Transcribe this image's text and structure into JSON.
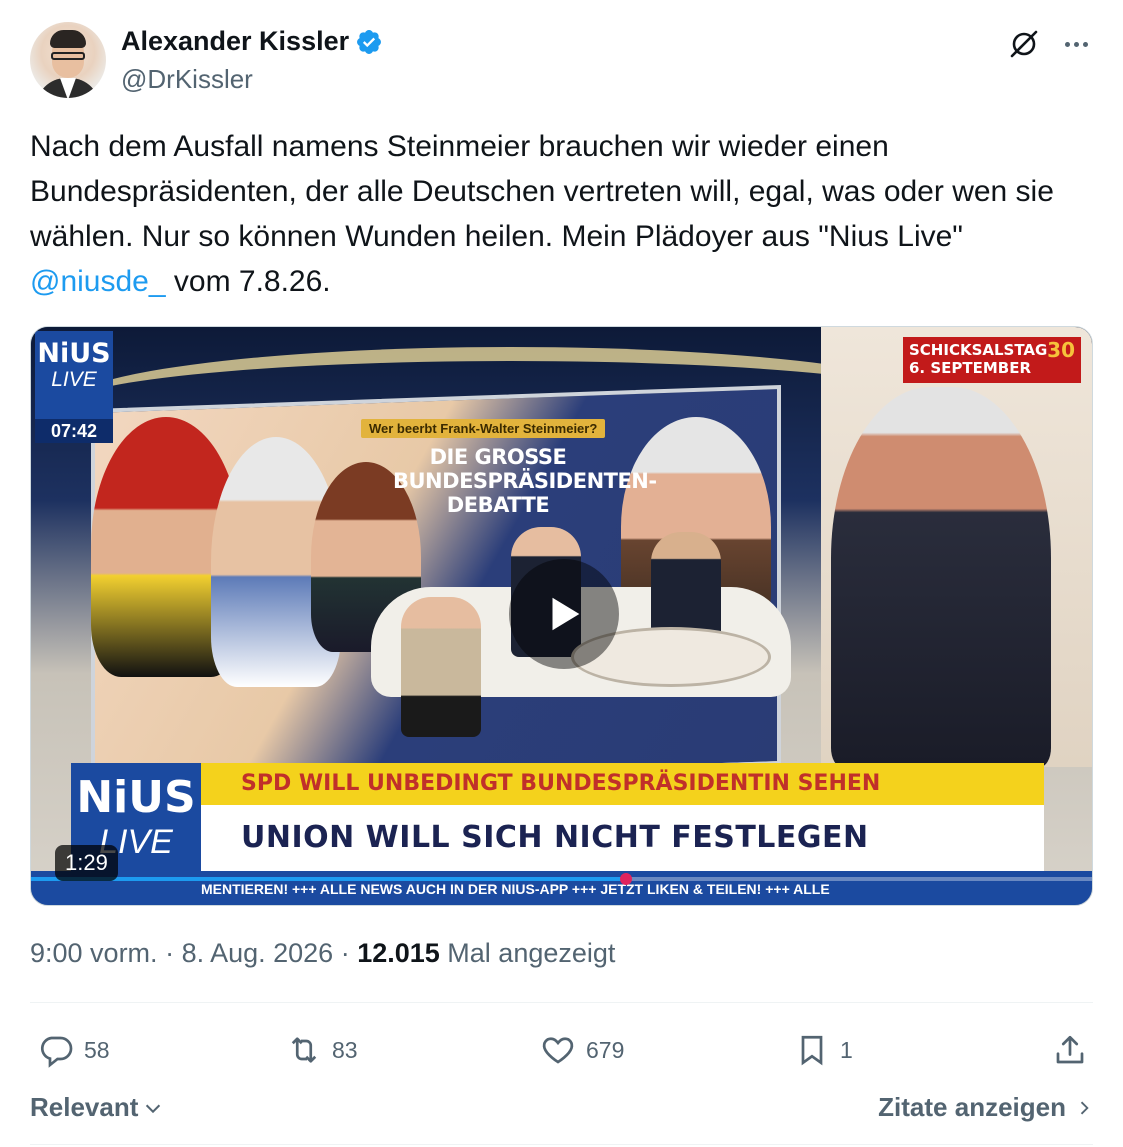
{
  "author": {
    "name": "Alexander Kissler",
    "handle": "@DrKissler",
    "verified": true
  },
  "tweet": {
    "text_before": "Nach dem Ausfall namens Steinmeier brauchen wir wieder einen Bundespräsidenten, der alle Deutschen vertreten will, egal, was oder wen sie wählen. Nur so können Wunden heilen. Mein Plädoyer aus \"Nius Live\" ",
    "mention": "@niusde_",
    "text_after": " vom 7.8.26."
  },
  "video": {
    "duration": "1:29",
    "progress_fraction": 0.56,
    "overlay": {
      "logo_top_line1": "NiUS",
      "logo_top_line2": "LIVE",
      "clock": "07:42",
      "kicker": "Wer beerbt Frank-Walter Steinmeier?",
      "debate_title": "DIE GROSSE BUNDESPRÄSIDENTEN-DEBATTE",
      "countdown_line1": "SCHICKSALSTAG",
      "countdown_line2": "6. SEPTEMBER",
      "countdown_days": "30",
      "banner_top": "SPD WILL UNBEDINGT BUNDESPRÄSIDENTIN SEHEN",
      "banner_main": "UNION WILL SICH NICHT FESTLEGEN",
      "logo_bottom_line1": "NiUS",
      "logo_bottom_line2": "LIVE",
      "ticker": "MENTIEREN!   +++   ALLE NEWS AUCH IN DER NIUS-APP   +++   JETZT LIKEN & TEILEN!   +++   ALLE"
    }
  },
  "meta": {
    "time": "9:00 vorm.",
    "separator": " · ",
    "date": "8. Aug. 2026",
    "views_count": "12.015",
    "views_label": " Mal angezeigt"
  },
  "actions": {
    "replies": "58",
    "reposts": "83",
    "likes": "679",
    "bookmarks": "1"
  },
  "footer": {
    "sort_label": "Relevant",
    "quotes_label": "Zitate anzeigen"
  },
  "colors": {
    "accent": "#1d9bf0",
    "text": "#0f1419",
    "muted": "#536471",
    "nius_blue": "#1b4aa0",
    "banner_yellow": "#f4d21c"
  }
}
